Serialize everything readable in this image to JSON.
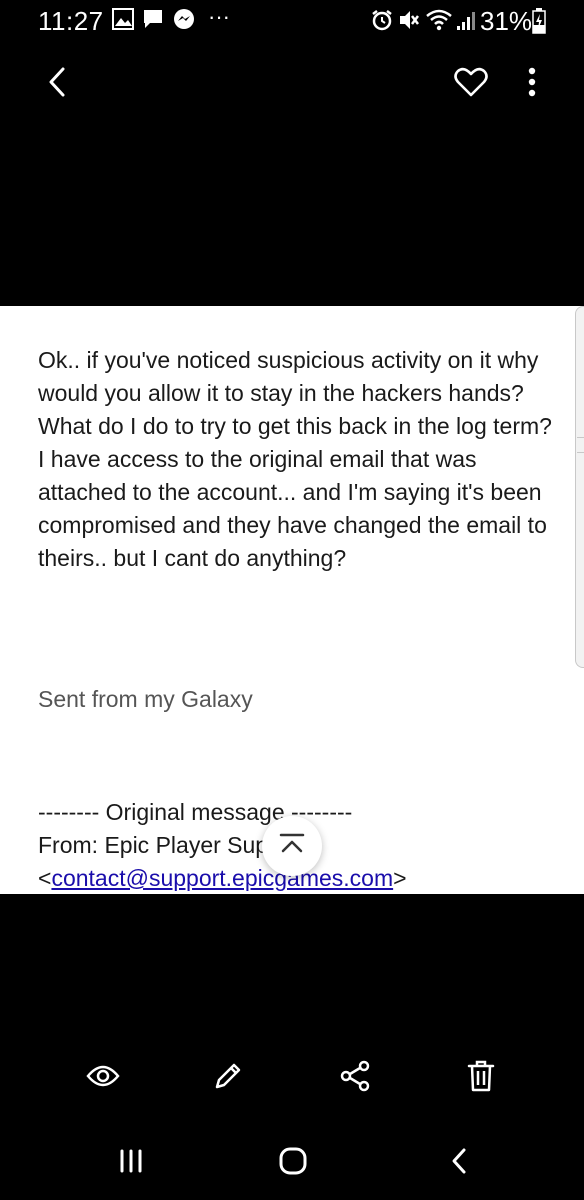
{
  "status_bar": {
    "time": "11:27",
    "battery": "31%",
    "more": "···",
    "left_icons": [
      "image-icon",
      "message-icon",
      "messenger-icon",
      "more-dots-icon"
    ],
    "right_icons": [
      "alarm-icon",
      "mute-icon",
      "wifi-icon",
      "signal-icon",
      "battery-charging-icon"
    ]
  },
  "toolbar": {
    "back": "back-arrow-icon",
    "favorite": "heart-icon",
    "menu": "more-vert-icon"
  },
  "message": {
    "body": "Ok.. if you've noticed suspicious activity on it why would you allow it to stay in the hackers hands? What do I do to try to get this back in the log term? I have access to the original email that was attached to the account... and I'm saying it's been compromised and they have changed the email to theirs.. but I cant do anything?",
    "signature": "Sent from my Galaxy",
    "original_header": "-------- Original message --------",
    "from_label": "From: Epic Player Sup",
    "email_open": "<",
    "email": "contact@support.epicgames.com",
    "email_close": ">"
  },
  "bottom_actions": [
    "eye-icon",
    "edit-icon",
    "share-icon",
    "delete-icon"
  ],
  "navigation": [
    "recent-apps-icon",
    "home-icon",
    "back-icon"
  ],
  "colors": {
    "background": "#000000",
    "content_bg": "#ffffff",
    "link": "#1a0dab",
    "signature": "#555555"
  }
}
